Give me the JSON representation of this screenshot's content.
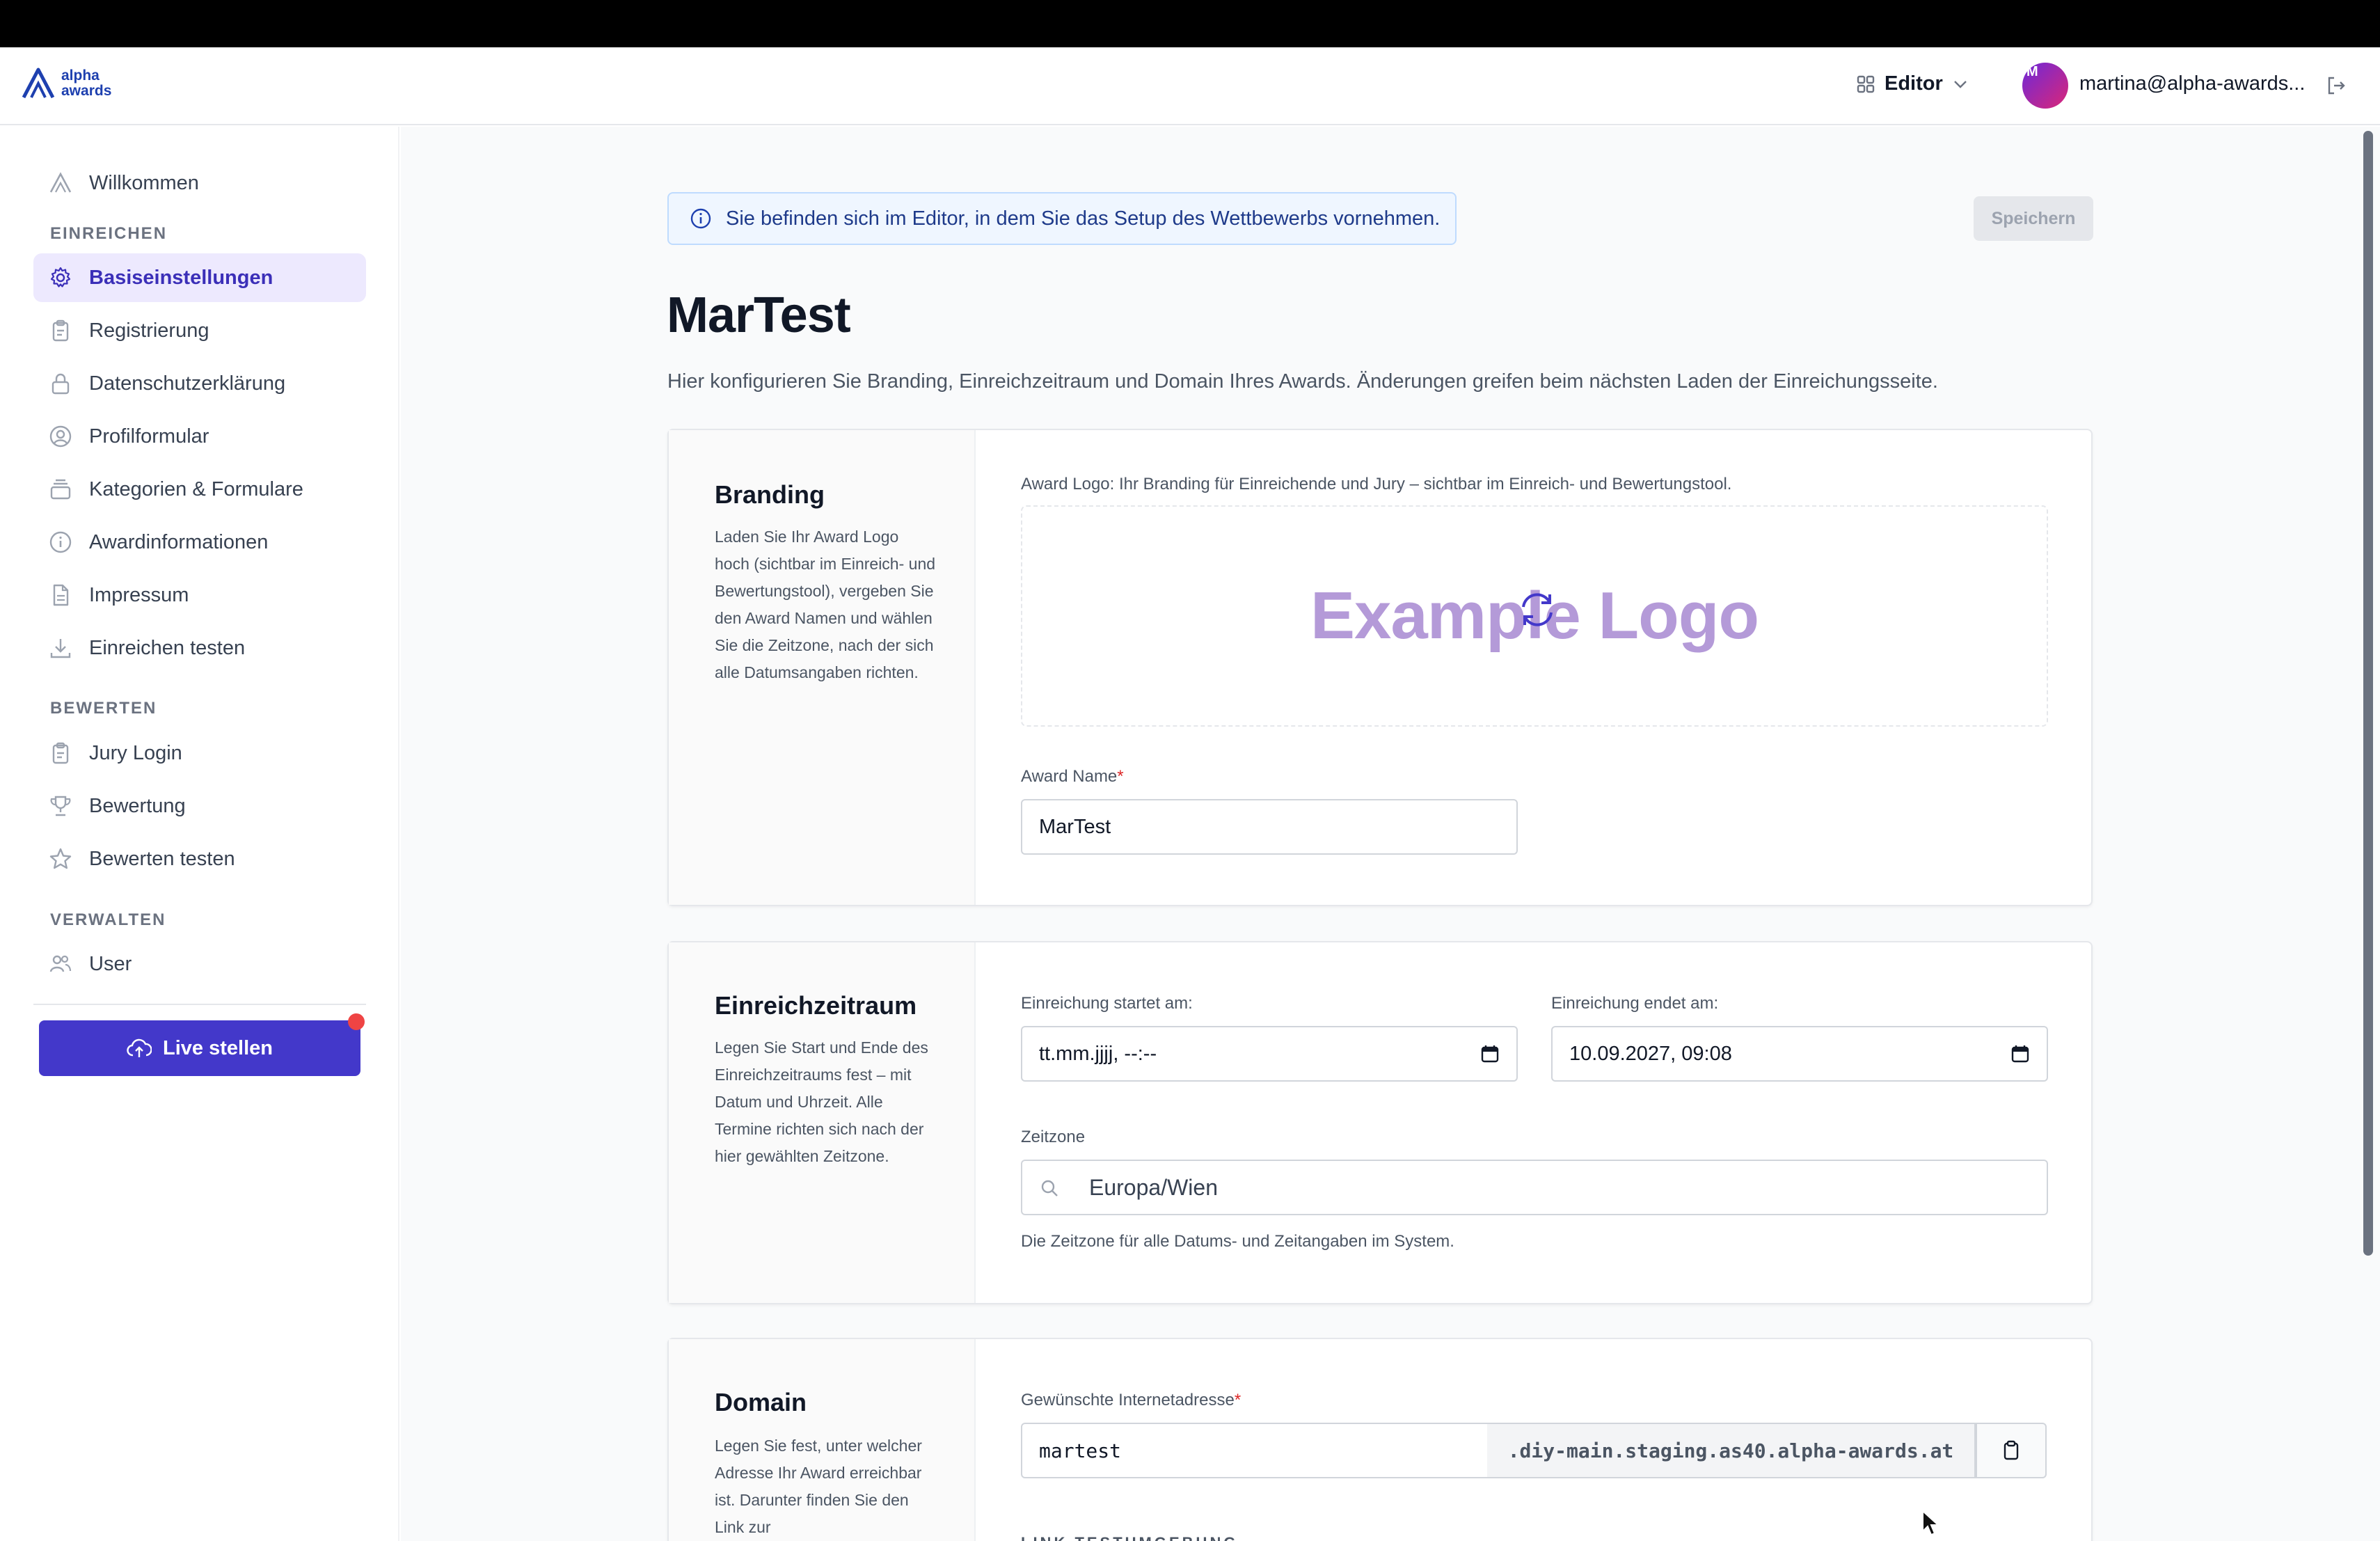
{
  "header": {
    "logo_line1": "alpha",
    "logo_line2": "awards",
    "mode_label": "Editor",
    "avatar_initial": "M",
    "user_email": "martina@alpha-awards..."
  },
  "sidebar": {
    "welcome": "Willkommen",
    "section_submit": "EINREICHEN",
    "submit_items": [
      {
        "label": "Basiseinstellungen",
        "icon": "gear-icon"
      },
      {
        "label": "Registrierung",
        "icon": "clipboard-icon"
      },
      {
        "label": "Datenschutzerklärung",
        "icon": "lock-icon"
      },
      {
        "label": "Profilformular",
        "icon": "user-circle-icon"
      },
      {
        "label": "Kategorien & Formulare",
        "icon": "stack-icon"
      },
      {
        "label": "Awardinformationen",
        "icon": "info-icon"
      },
      {
        "label": "Impressum",
        "icon": "document-icon"
      },
      {
        "label": "Einreichen testen",
        "icon": "download-icon"
      }
    ],
    "section_rate": "BEWERTEN",
    "rate_items": [
      {
        "label": "Jury Login",
        "icon": "clipboard-icon"
      },
      {
        "label": "Bewertung",
        "icon": "trophy-icon"
      },
      {
        "label": "Bewerten testen",
        "icon": "star-icon"
      }
    ],
    "section_manage": "VERWALTEN",
    "manage_items": [
      {
        "label": "User",
        "icon": "users-icon"
      }
    ],
    "live_button": "Live stellen"
  },
  "main": {
    "info_text": "Sie befinden sich im Editor, in dem Sie das Setup des Wettbewerbs vornehmen.",
    "save_label": "Speichern",
    "title": "MarTest",
    "subtitle": "Hier konfigurieren Sie Branding, Einreichzeitraum und Domain Ihres Awards. Änderungen greifen beim nächsten Laden der Einreichungsseite."
  },
  "branding": {
    "heading": "Branding",
    "description": "Laden Sie Ihr Award Logo hoch (sichtbar im Einreich- und Bewertungstool), vergeben Sie den Award Namen und wählen Sie die Zeitzone, nach der sich alle Datumsangaben richten.",
    "logo_label": "Award Logo: Ihr Branding für Einreichende und Jury – sichtbar im Einreich- und Bewertungstool.",
    "logo_text": "Example Logo",
    "name_label": "Award Name",
    "name_required": "*",
    "name_value": "MarTest"
  },
  "period": {
    "heading": "Einreichzeitraum",
    "description": "Legen Sie Start und Ende des Einreichzeitraums fest – mit Datum und Uhrzeit. Alle Termine richten sich nach der hier gewählten Zeitzone.",
    "start_label": "Einreichung startet am:",
    "start_value": "tt.mm.jjjj, --:--",
    "end_label": "Einreichung endet am:",
    "end_value": "10.09.2027, 09:08",
    "timezone_label": "Zeitzone",
    "timezone_value": "Europa/Wien",
    "timezone_help": "Die Zeitzone für alle Datums- und Zeitangaben im System."
  },
  "domain": {
    "heading": "Domain",
    "description": "Legen Sie fest, unter welcher Adresse Ihr Award erreichbar ist. Darunter finden Sie den Link zur",
    "address_label": "Gewünschte Internetadresse",
    "address_required": "*",
    "address_value": "martest",
    "suffix": ".diy-main.staging.as40.alpha-awards.at",
    "test_label": "LINK TESTUMGEBUNG"
  },
  "colors": {
    "accent": "#4338ca",
    "active_bg": "#ede9fe",
    "info_bg": "#eff6ff",
    "logo_color": "#b49ad8"
  }
}
